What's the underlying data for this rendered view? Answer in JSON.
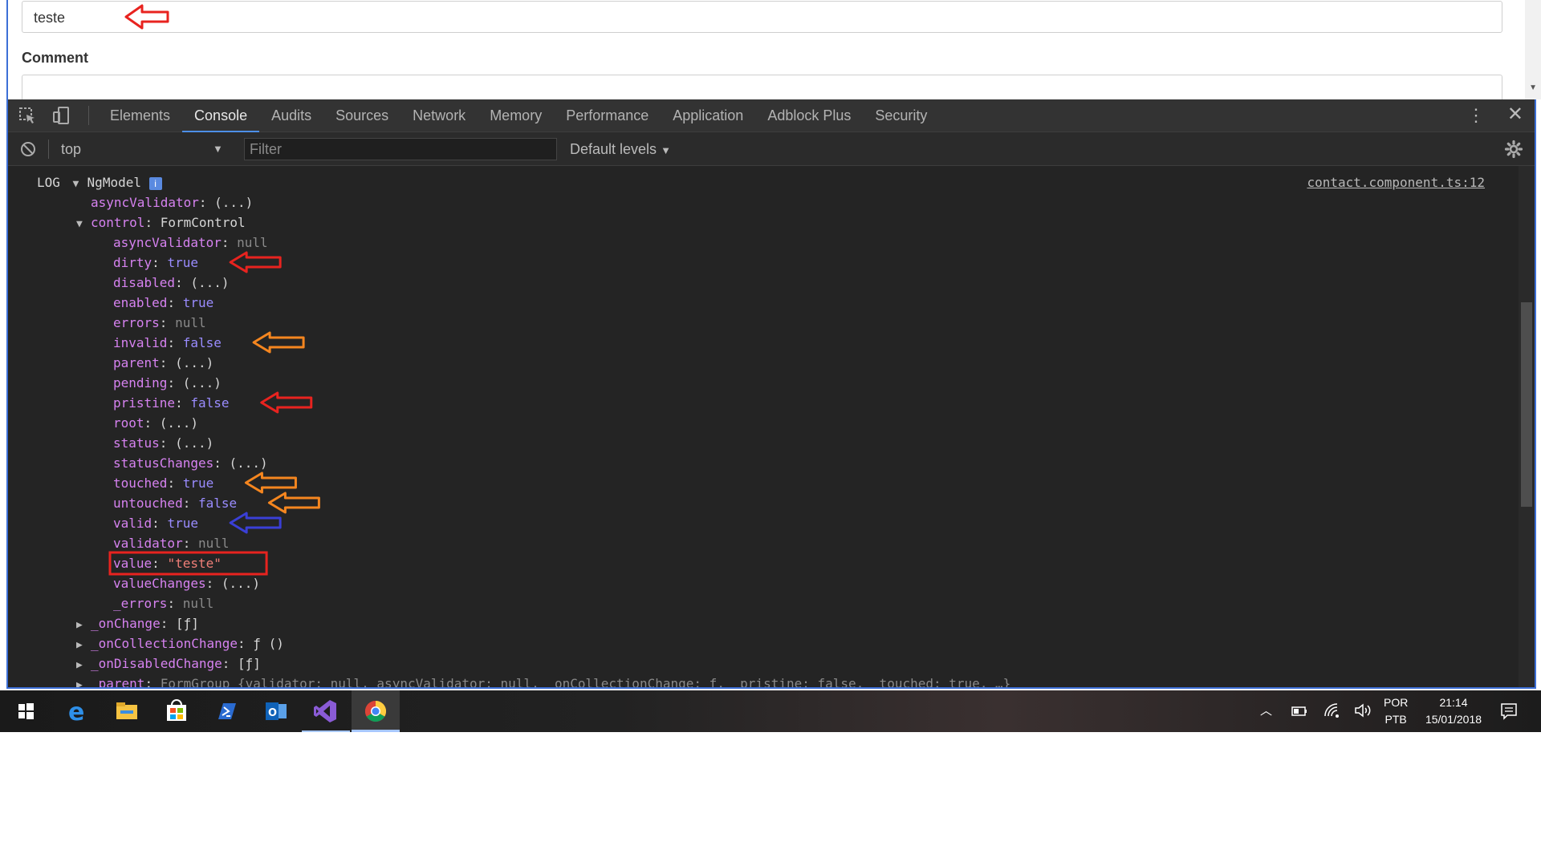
{
  "page": {
    "name_value": "teste",
    "comment_label": "Comment"
  },
  "devtools": {
    "tabs": [
      {
        "label": "Elements",
        "active": false
      },
      {
        "label": "Console",
        "active": true
      },
      {
        "label": "Audits",
        "active": false
      },
      {
        "label": "Sources",
        "active": false
      },
      {
        "label": "Network",
        "active": false
      },
      {
        "label": "Memory",
        "active": false
      },
      {
        "label": "Performance",
        "active": false
      },
      {
        "label": "Application",
        "active": false
      },
      {
        "label": "Adblock Plus",
        "active": false
      },
      {
        "label": "Security",
        "active": false
      }
    ],
    "console": {
      "context": "top",
      "filter_placeholder": "Filter",
      "levels": "Default levels",
      "log_label": "LOG",
      "object_name": "NgModel",
      "info_badge": "i",
      "source": "contact.component.ts:12",
      "lines": [
        {
          "indent": 1,
          "expander": "",
          "key": "asyncValidator",
          "value": "(...)",
          "vtype": "plain"
        },
        {
          "indent": 0,
          "expander": "▼",
          "key": "control",
          "value": "FormControl",
          "vtype": "plain"
        },
        {
          "indent": 2,
          "expander": "",
          "key": "asyncValidator",
          "value": "null",
          "vtype": "nul"
        },
        {
          "indent": 2,
          "expander": "",
          "key": "dirty",
          "value": "true",
          "vtype": "bool"
        },
        {
          "indent": 2,
          "expander": "",
          "key": "disabled",
          "value": "(...)",
          "vtype": "plain"
        },
        {
          "indent": 2,
          "expander": "",
          "key": "enabled",
          "value": "true",
          "vtype": "bool"
        },
        {
          "indent": 2,
          "expander": "",
          "key": "errors",
          "value": "null",
          "vtype": "nul"
        },
        {
          "indent": 2,
          "expander": "",
          "key": "invalid",
          "value": "false",
          "vtype": "bool"
        },
        {
          "indent": 2,
          "expander": "",
          "key": "parent",
          "value": "(...)",
          "vtype": "plain"
        },
        {
          "indent": 2,
          "expander": "",
          "key": "pending",
          "value": "(...)",
          "vtype": "plain"
        },
        {
          "indent": 2,
          "expander": "",
          "key": "pristine",
          "value": "false",
          "vtype": "bool"
        },
        {
          "indent": 2,
          "expander": "",
          "key": "root",
          "value": "(...)",
          "vtype": "plain"
        },
        {
          "indent": 2,
          "expander": "",
          "key": "status",
          "value": "(...)",
          "vtype": "plain"
        },
        {
          "indent": 2,
          "expander": "",
          "key": "statusChanges",
          "value": "(...)",
          "vtype": "plain"
        },
        {
          "indent": 2,
          "expander": "",
          "key": "touched",
          "value": "true",
          "vtype": "bool"
        },
        {
          "indent": 2,
          "expander": "",
          "key": "untouched",
          "value": "false",
          "vtype": "bool"
        },
        {
          "indent": 2,
          "expander": "",
          "key": "valid",
          "value": "true",
          "vtype": "bool"
        },
        {
          "indent": 2,
          "expander": "",
          "key": "validator",
          "value": "null",
          "vtype": "nul"
        },
        {
          "indent": 2,
          "expander": "",
          "key": "value",
          "value": "\"teste\"",
          "vtype": "str"
        },
        {
          "indent": 2,
          "expander": "",
          "key": "valueChanges",
          "value": "(...)",
          "vtype": "plain"
        },
        {
          "indent": 2,
          "expander": "",
          "key": "_errors",
          "value": "null",
          "vtype": "nul"
        },
        {
          "indent": 1,
          "expander": "▶",
          "key": "_onChange",
          "value": "[ƒ]",
          "vtype": "plain"
        },
        {
          "indent": 1,
          "expander": "▶",
          "key": "_onCollectionChange",
          "value": "ƒ ()",
          "vtype": "plain"
        },
        {
          "indent": 1,
          "expander": "▶",
          "key": "_onDisabledChange",
          "value": "[ƒ]",
          "vtype": "plain"
        },
        {
          "indent": 1,
          "expander": "▶",
          "key": "_parent",
          "value": "FormGroup {validator: null, asyncValidator: null, _onCollectionChange: ƒ, _pristine: false, _touched: true, …}",
          "vtype": "dim"
        }
      ]
    }
  },
  "annotations": {
    "arrow_colors": {
      "red": "#e8231f",
      "orange": "#f5861f",
      "blue": "#3a3fd6"
    },
    "arrows": [
      {
        "target": "name-field",
        "color": "red"
      },
      {
        "target": "dirty",
        "color": "red"
      },
      {
        "target": "invalid",
        "color": "orange"
      },
      {
        "target": "pristine",
        "color": "red"
      },
      {
        "target": "touched",
        "color": "orange"
      },
      {
        "target": "untouched",
        "color": "orange"
      },
      {
        "target": "valid",
        "color": "blue"
      }
    ],
    "box": {
      "target": "value",
      "color": "red"
    }
  },
  "taskbar": {
    "apps": [
      "start-icon",
      "edge-icon",
      "file-explorer-icon",
      "store-icon",
      "powershell-icon",
      "outlook-icon",
      "visual-studio-icon",
      "chrome-icon"
    ],
    "active_app": "chrome-icon",
    "lang_top": "POR",
    "lang_bottom": "PTB",
    "time": "21:14",
    "date": "15/01/2018"
  },
  "colors": {
    "devtools_bg": "#242424",
    "key": "#d682f0",
    "boolean": "#9a8cff",
    "null": "#8a8a8a",
    "string": "#f07f78",
    "accent": "#4d8fe8"
  }
}
